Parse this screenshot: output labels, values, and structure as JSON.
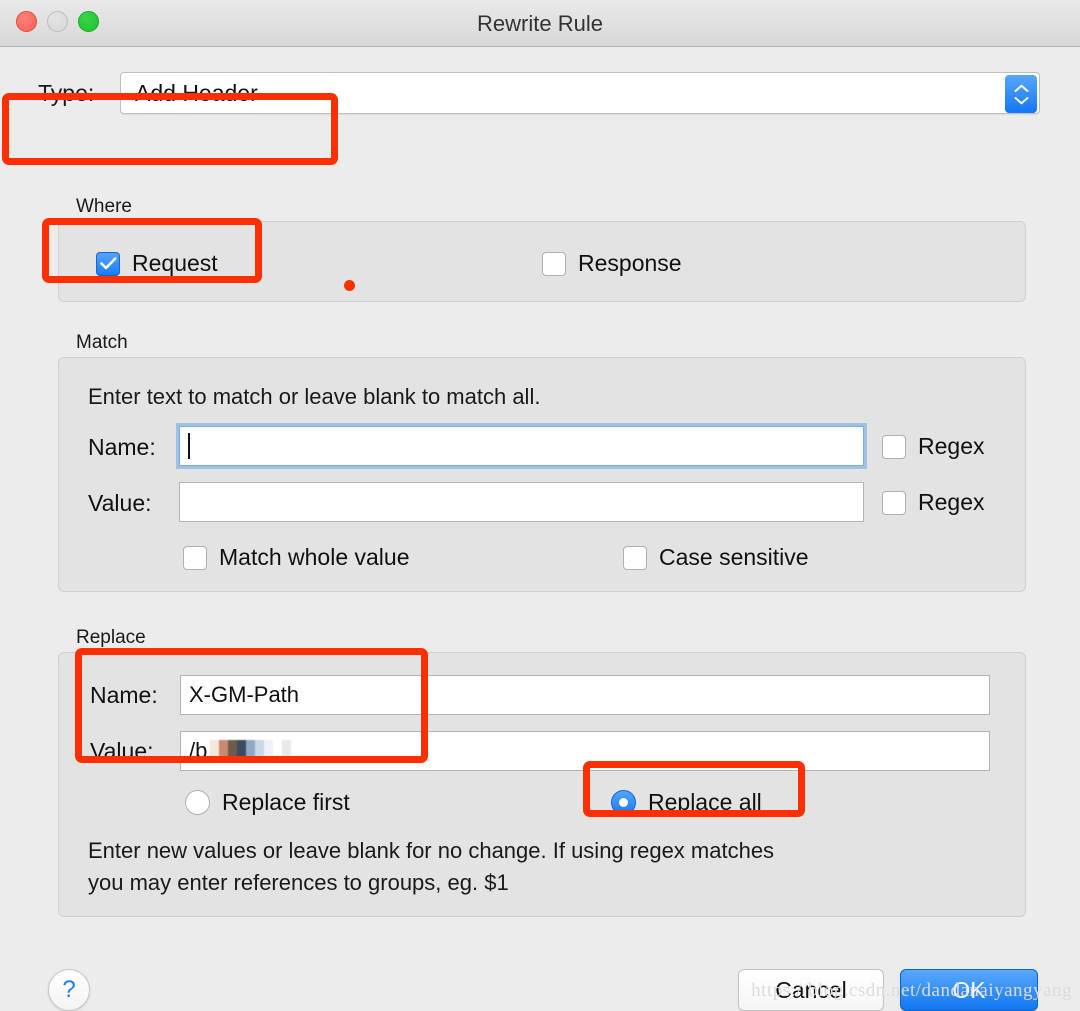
{
  "window": {
    "title": "Rewrite Rule",
    "traffic_lights": [
      "close-button",
      "minimize-button",
      "zoom-button"
    ]
  },
  "type_row": {
    "label": "Type:",
    "selected_value": "Add Header",
    "stepper_icon": "stepper-up-down-icon"
  },
  "where": {
    "group_label": "Where",
    "options": [
      {
        "label": "Request",
        "checked": true
      },
      {
        "label": "Response",
        "checked": false
      }
    ]
  },
  "match": {
    "group_label": "Match",
    "hint": "Enter text to match or leave blank to match all.",
    "name_label": "Name:",
    "name_value": "",
    "name_regex_label": "Regex",
    "name_regex_checked": false,
    "value_label": "Value:",
    "value_value": "",
    "value_regex_label": "Regex",
    "value_regex_checked": false,
    "match_whole_value_label": "Match whole value",
    "match_whole_value_checked": false,
    "case_sensitive_label": "Case sensitive",
    "case_sensitive_checked": false
  },
  "replace": {
    "group_label": "Replace",
    "name_label": "Name:",
    "name_value": "X-GM-Path",
    "value_label": "Value:",
    "value_value": "/b",
    "value_redacted": true,
    "radios": [
      {
        "label": "Replace first",
        "selected": false
      },
      {
        "label": "Replace all",
        "selected": true
      }
    ],
    "hint_line1": "Enter new values or leave blank for no change. If using regex matches",
    "hint_line2": "you may enter references to groups, eg. $1"
  },
  "footer": {
    "help_label": "?",
    "cancel_label": "Cancel",
    "ok_label": "OK"
  },
  "watermark": "https://blog.csdn.net/dandanaiyangyang",
  "annotations": {
    "accent_color": "#fb2f00",
    "boxes": [
      "type-row",
      "request-checkbox",
      "replace-name-value-fields",
      "replace-all-radio"
    ]
  }
}
